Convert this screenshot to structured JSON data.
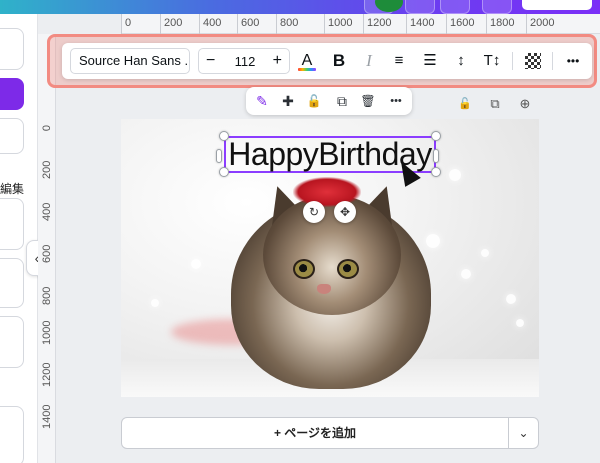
{
  "left_panel": {
    "edit_label": "編集",
    "collapse_icon": "‹"
  },
  "ruler_top": {
    "ticks": [
      "0",
      "200",
      "400",
      "600",
      "800",
      "1000",
      "1200",
      "1400",
      "1600",
      "1800",
      "2000"
    ]
  },
  "ruler_left": {
    "ticks": [
      "0",
      "200",
      "400",
      "600",
      "800",
      "1000",
      "1200",
      "1400"
    ]
  },
  "text_toolbar": {
    "font_name": "Source Han Sans ...",
    "font_size": "112",
    "decrease": "−",
    "increase": "+",
    "text_color_glyph": "A",
    "bold_glyph": "B",
    "italic_glyph": "I",
    "align_glyph": "≡",
    "list_glyph": "☰",
    "spacing_glyph": "↕",
    "text_effects_glyph": "T↕",
    "more_glyph": "•••"
  },
  "element_toolbar": {
    "magic_glyph": "✎",
    "comment_glyph": "✚",
    "lock_glyph": "🔓",
    "duplicate_glyph": "⧉",
    "delete_glyph": "🗑",
    "more_glyph": "•••"
  },
  "page_actions": {
    "lock_glyph": "🔓",
    "duplicate_glyph": "⧉",
    "add_glyph": "⊕"
  },
  "canvas": {
    "headline": "HappyBirthday",
    "rotate_glyph": "↻",
    "move_glyph": "✥"
  },
  "add_page": {
    "label": "+ ページを追加",
    "more": "⌄"
  },
  "colors": {
    "brand_purple": "#7d2ae8",
    "selection": "#8b3dff",
    "highlight": "#f28b82"
  }
}
